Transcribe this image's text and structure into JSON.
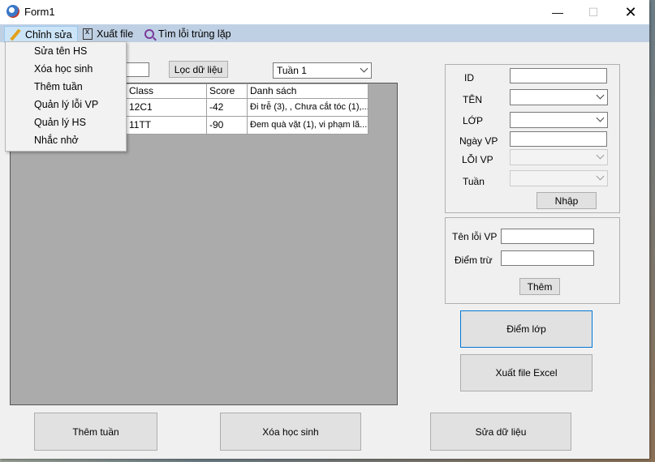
{
  "window": {
    "title": "Form1",
    "minimize": "—",
    "maximize": "☐",
    "close": "✕"
  },
  "menubar": {
    "items": [
      "Chỉnh sửa",
      "Xuất file",
      "Tìm lỗi trùng lặp"
    ]
  },
  "edit_menu": {
    "items": [
      "Sửa tên HS",
      "Xóa học sinh",
      "Thêm tuần",
      "Quản lý lỗi VP",
      "Quản lý HS",
      "Nhắc nhở"
    ]
  },
  "filter": {
    "button": "Lọc dữ liệu",
    "week": "Tuần 1"
  },
  "grid": {
    "columns": [
      "Class",
      "Score",
      "Danh sách"
    ],
    "rows": [
      {
        "class": "12C1",
        "score": "-42",
        "list": "Đi trễ (3), , Chưa cắt tóc (1),..."
      },
      {
        "class": "11TT",
        "score": "-90",
        "list": "Đem quà vặt (1), vi phạm lã..."
      }
    ]
  },
  "form": {
    "labels": {
      "id": "ID",
      "name": "TÊN",
      "class": "LỚP",
      "date": "Ngày VP",
      "violation": "LỖI VP",
      "week": "Tuần"
    },
    "submit": "Nhập"
  },
  "violation_form": {
    "name_label": "Tên lỗi VP",
    "points_label": "Điểm trừ",
    "add": "Thêm"
  },
  "actions": {
    "class_points": "Điểm lớp",
    "export_excel": "Xuất file Excel",
    "add_week": "Thêm tuần",
    "delete_student": "Xóa học sinh",
    "edit_data": "Sửa dữ liệu"
  }
}
